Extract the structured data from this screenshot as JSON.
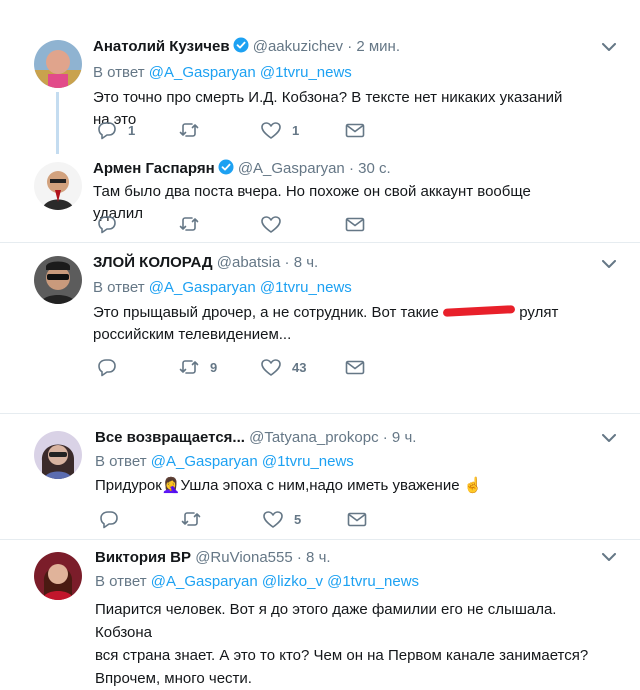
{
  "tweets": [
    {
      "name": "Анатолий Кузичев",
      "handle": "@aakuzichev",
      "time": "· 2 мин.",
      "reply_prefix": "В ответ",
      "reply_mentions": "@A_Gasparyan @1tvru_news",
      "text": "Это точно про смерть И.Д. Кобзона? В тексте нет никаких указаний на это",
      "replies": "1",
      "retweets": "",
      "likes": "1"
    },
    {
      "name": "Армен Гаспарян",
      "handle": "@A_Gasparyan",
      "time": "· 30 с.",
      "text": "Там было два поста вчера. Но похоже он свой аккаунт вообще удалил",
      "replies": "",
      "retweets": "",
      "likes": ""
    },
    {
      "name": "ЗЛОЙ КОЛОРАД",
      "handle": "@abatsia",
      "time": "· 8 ч.",
      "reply_prefix": "В ответ",
      "reply_mentions": "@A_Gasparyan @1tvru_news",
      "text_part1": "Это прыщавый дрочер, а не сотрудник. Вот такие",
      "text_part2": "рулят",
      "text_line2": "российским телевидением...",
      "replies": "",
      "retweets": "9",
      "likes": "43"
    },
    {
      "name": "Все возвращается...",
      "handle": "@Tatyana_prokopc",
      "time": "· 9 ч.",
      "reply_prefix": "В ответ",
      "reply_mentions": "@A_Gasparyan @1tvru_news",
      "text": "Придурок🤦‍♀️Ушла эпоха с ним,надо иметь уважение ☝️",
      "replies": "",
      "retweets": "",
      "likes": "5"
    },
    {
      "name": "Виктория ВР",
      "handle": "@RuViona555",
      "time": "· 8 ч.",
      "reply_prefix": "В ответ",
      "reply_mentions": "@A_Gasparyan @lizko_v @1tvru_news",
      "text_line1": "Пиарится человек. Вот я до этого даже фамилии его не слышала. Кобзона",
      "text_line2": "вся страна знает. А это то кто? Чем он на Первом канале занимается?",
      "text_line3": "Впрочем, много чести."
    }
  ],
  "colors": {
    "accent": "#1da1f2",
    "muted": "#657786",
    "thread": "#c4dcf0",
    "divider": "#e6ecf0"
  }
}
